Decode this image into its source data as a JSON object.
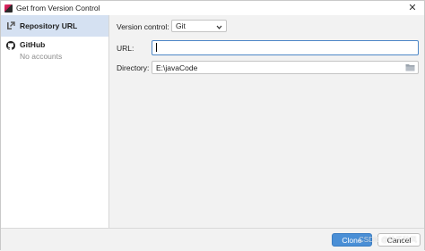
{
  "window": {
    "title": "Get from Version Control",
    "close_glyph": "✕"
  },
  "sidebar": {
    "items": [
      {
        "label": "Repository URL",
        "icon": "vcs-branch-icon",
        "selected": true
      },
      {
        "label": "GitHub",
        "sublabel": "No accounts",
        "icon": "github-icon",
        "selected": false
      }
    ]
  },
  "form": {
    "version_control_label": "Version control:",
    "version_control_value": "Git",
    "url_label": "URL:",
    "url_value": "",
    "directory_label": "Directory:",
    "directory_value": "E:\\javaCode"
  },
  "footer": {
    "clone_label": "Clone",
    "cancel_label": "Cancel",
    "watermark": "CSDN @快乐秋风"
  },
  "colors": {
    "accent": "#4a8fd6",
    "selected_row": "#d5e1f2",
    "focus_border": "#4d87c7"
  }
}
